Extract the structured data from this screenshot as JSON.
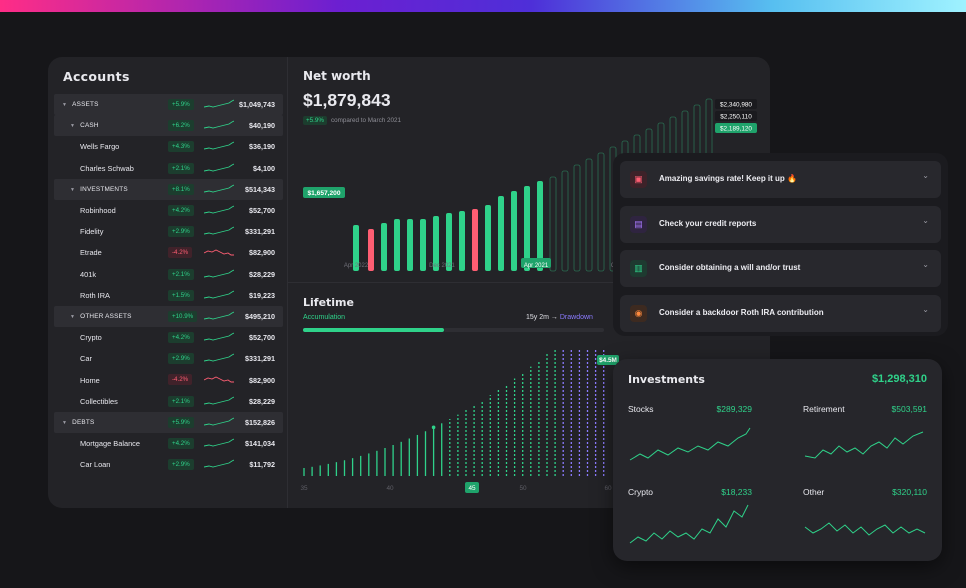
{
  "accounts": {
    "title": "Accounts",
    "rows": [
      {
        "name": "ASSETS",
        "change": "+5.9%",
        "value": "$1,049,743",
        "level": 0,
        "group": true,
        "trend": "up"
      },
      {
        "name": "CASH",
        "change": "+6.2%",
        "value": "$40,190",
        "level": 1,
        "group": true,
        "trend": "up"
      },
      {
        "name": "Wells Fargo",
        "change": "+4.3%",
        "value": "$36,190",
        "level": 2,
        "group": false,
        "trend": "up"
      },
      {
        "name": "Charles Schwab",
        "change": "+2.1%",
        "value": "$4,100",
        "level": 2,
        "group": false,
        "trend": "up"
      },
      {
        "name": "INVESTMENTS",
        "change": "+8.1%",
        "value": "$514,343",
        "level": 1,
        "group": true,
        "trend": "up"
      },
      {
        "name": "Robinhood",
        "change": "+4.2%",
        "value": "$52,700",
        "level": 2,
        "group": false,
        "trend": "up"
      },
      {
        "name": "Fidelity",
        "change": "+2.9%",
        "value": "$331,291",
        "level": 2,
        "group": false,
        "trend": "up"
      },
      {
        "name": "Etrade",
        "change": "-4.2%",
        "value": "$82,900",
        "level": 2,
        "group": false,
        "trend": "down"
      },
      {
        "name": "401k",
        "change": "+2.1%",
        "value": "$28,229",
        "level": 2,
        "group": false,
        "trend": "up"
      },
      {
        "name": "Roth IRA",
        "change": "+1.5%",
        "value": "$19,223",
        "level": 2,
        "group": false,
        "trend": "up"
      },
      {
        "name": "OTHER ASSETS",
        "change": "+10.9%",
        "value": "$495,210",
        "level": 1,
        "group": true,
        "trend": "up"
      },
      {
        "name": "Crypto",
        "change": "+4.2%",
        "value": "$52,700",
        "level": 2,
        "group": false,
        "trend": "up"
      },
      {
        "name": "Car",
        "change": "+2.9%",
        "value": "$331,291",
        "level": 2,
        "group": false,
        "trend": "up"
      },
      {
        "name": "Home",
        "change": "-4.2%",
        "value": "$82,900",
        "level": 2,
        "group": false,
        "trend": "down"
      },
      {
        "name": "Collectibles",
        "change": "+2.1%",
        "value": "$28,229",
        "level": 2,
        "group": false,
        "trend": "up"
      },
      {
        "name": "DEBTS",
        "change": "+5.9%",
        "value": "$152,826",
        "level": 0,
        "group": true,
        "trend": "up"
      },
      {
        "name": "Mortgage Balance",
        "change": "+4.2%",
        "value": "$141,034",
        "level": 2,
        "group": false,
        "trend": "up"
      },
      {
        "name": "Car Loan",
        "change": "+2.9%",
        "value": "$11,792",
        "level": 2,
        "group": false,
        "trend": "up"
      }
    ]
  },
  "net_worth": {
    "title": "Net worth",
    "value": "$1,879,843",
    "change": "+5.9%",
    "compare": "compared to March 2021",
    "start_label": "$1,657,200",
    "right_labels": [
      "$2,340,980",
      "$2,250,110",
      "$2,189,120"
    ],
    "axis_labels": [
      "Apr 2022",
      "Dec 2021",
      "Apr 2021",
      "Oct 2020"
    ],
    "selected_axis": "Apr 2021"
  },
  "lifetime": {
    "title": "Lifetime",
    "accumulation_label": "Accumulation",
    "duration": "15y 2m →",
    "drawdown_label": "Drawdown",
    "peak_label": "$4.5M",
    "x_ticks": [
      "35",
      "40",
      "45",
      "50",
      "60"
    ],
    "selected_tick": "45"
  },
  "suggestions": [
    {
      "label": "Amazing savings rate! Keep it up 🔥",
      "icon": "piggy-bank-icon",
      "color": "#ff5e73",
      "bg": "#3d2229"
    },
    {
      "label": "Check your credit reports",
      "icon": "report-icon",
      "color": "#a878ff",
      "bg": "#2f2440"
    },
    {
      "label": "Consider obtaining a will and/or trust",
      "icon": "briefcase-icon",
      "color": "#2fd28a",
      "bg": "#1e3a30"
    },
    {
      "label": "Consider a backdoor Roth IRA contribution",
      "icon": "money-icon",
      "color": "#ff8a3d",
      "bg": "#3d2a20"
    }
  ],
  "investments": {
    "title": "Investments",
    "total": "$1,298,310",
    "items": [
      {
        "name": "Stocks",
        "value": "$289,329"
      },
      {
        "name": "Retirement",
        "value": "$503,591"
      },
      {
        "name": "Crypto",
        "value": "$18,233"
      },
      {
        "name": "Other",
        "value": "$320,110"
      }
    ]
  },
  "colors": {
    "positive": "#2fd28a",
    "negative": "#ff5e73",
    "drawdown": "#8b7bff",
    "background": "#161619",
    "panel": "#232327"
  }
}
